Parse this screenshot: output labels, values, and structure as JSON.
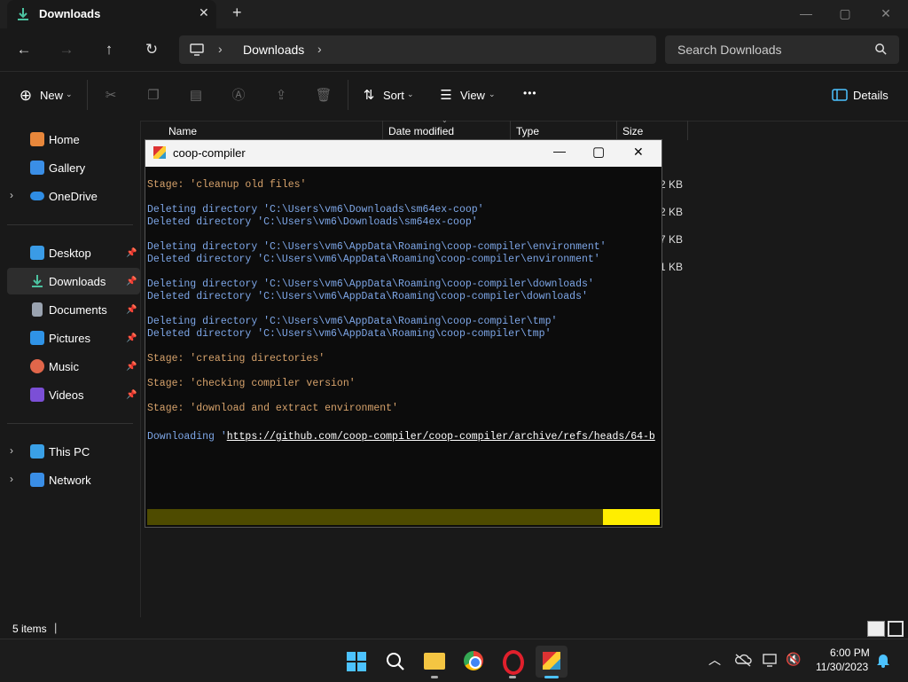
{
  "window": {
    "tab_title": "Downloads",
    "new_tab": "+",
    "minimize": "—",
    "maximize": "▢",
    "close": "✕"
  },
  "address": {
    "crumb": "Downloads",
    "search_placeholder": "Search Downloads"
  },
  "toolbar": {
    "new_label": "New",
    "sort_label": "Sort",
    "view_label": "View",
    "more": "•••",
    "details_label": "Details"
  },
  "sidebar": {
    "items": [
      {
        "label": "Home"
      },
      {
        "label": "Gallery"
      },
      {
        "label": "OneDrive"
      },
      {
        "label": "Desktop"
      },
      {
        "label": "Downloads"
      },
      {
        "label": "Documents"
      },
      {
        "label": "Pictures"
      },
      {
        "label": "Music"
      },
      {
        "label": "Videos"
      },
      {
        "label": "This PC"
      },
      {
        "label": "Network"
      }
    ]
  },
  "columns": {
    "name": "Name",
    "date": "Date modified",
    "type": "Type",
    "size": "Size"
  },
  "files": {
    "sizes": [
      "2 KB",
      "2 KB",
      "7 KB",
      "1 KB"
    ]
  },
  "status": {
    "items": "5 items"
  },
  "console": {
    "title": "coop-compiler",
    "lines": [
      "Stage: 'cleanup old files'",
      "Deleting directory 'C:\\Users\\vm6\\Downloads\\sm64ex-coop'",
      "Deleted directory 'C:\\Users\\vm6\\Downloads\\sm64ex-coop'",
      "Deleting directory 'C:\\Users\\vm6\\AppData\\Roaming\\coop-compiler\\environment'",
      "Deleted directory 'C:\\Users\\vm6\\AppData\\Roaming\\coop-compiler\\environment'",
      "Deleting directory 'C:\\Users\\vm6\\AppData\\Roaming\\coop-compiler\\downloads'",
      "Deleted directory 'C:\\Users\\vm6\\AppData\\Roaming\\coop-compiler\\downloads'",
      "Deleting directory 'C:\\Users\\vm6\\AppData\\Roaming\\coop-compiler\\tmp'",
      "Deleted directory 'C:\\Users\\vm6\\AppData\\Roaming\\coop-compiler\\tmp'",
      "Stage: 'creating directories'",
      "Stage: 'checking compiler version'",
      "Stage: 'download and extract environment'"
    ],
    "download_prefix": "Downloading '",
    "download_url": "https://github.com/coop-compiler/coop-compiler/archive/refs/heads/64-b",
    "progress": 0.89
  },
  "clock": {
    "time": "6:00 PM",
    "date": "11/30/2023"
  },
  "colors": {
    "accent": "#4cc2ff",
    "progress_fill": "#ffee00",
    "progress_track": "#4e4b00"
  }
}
